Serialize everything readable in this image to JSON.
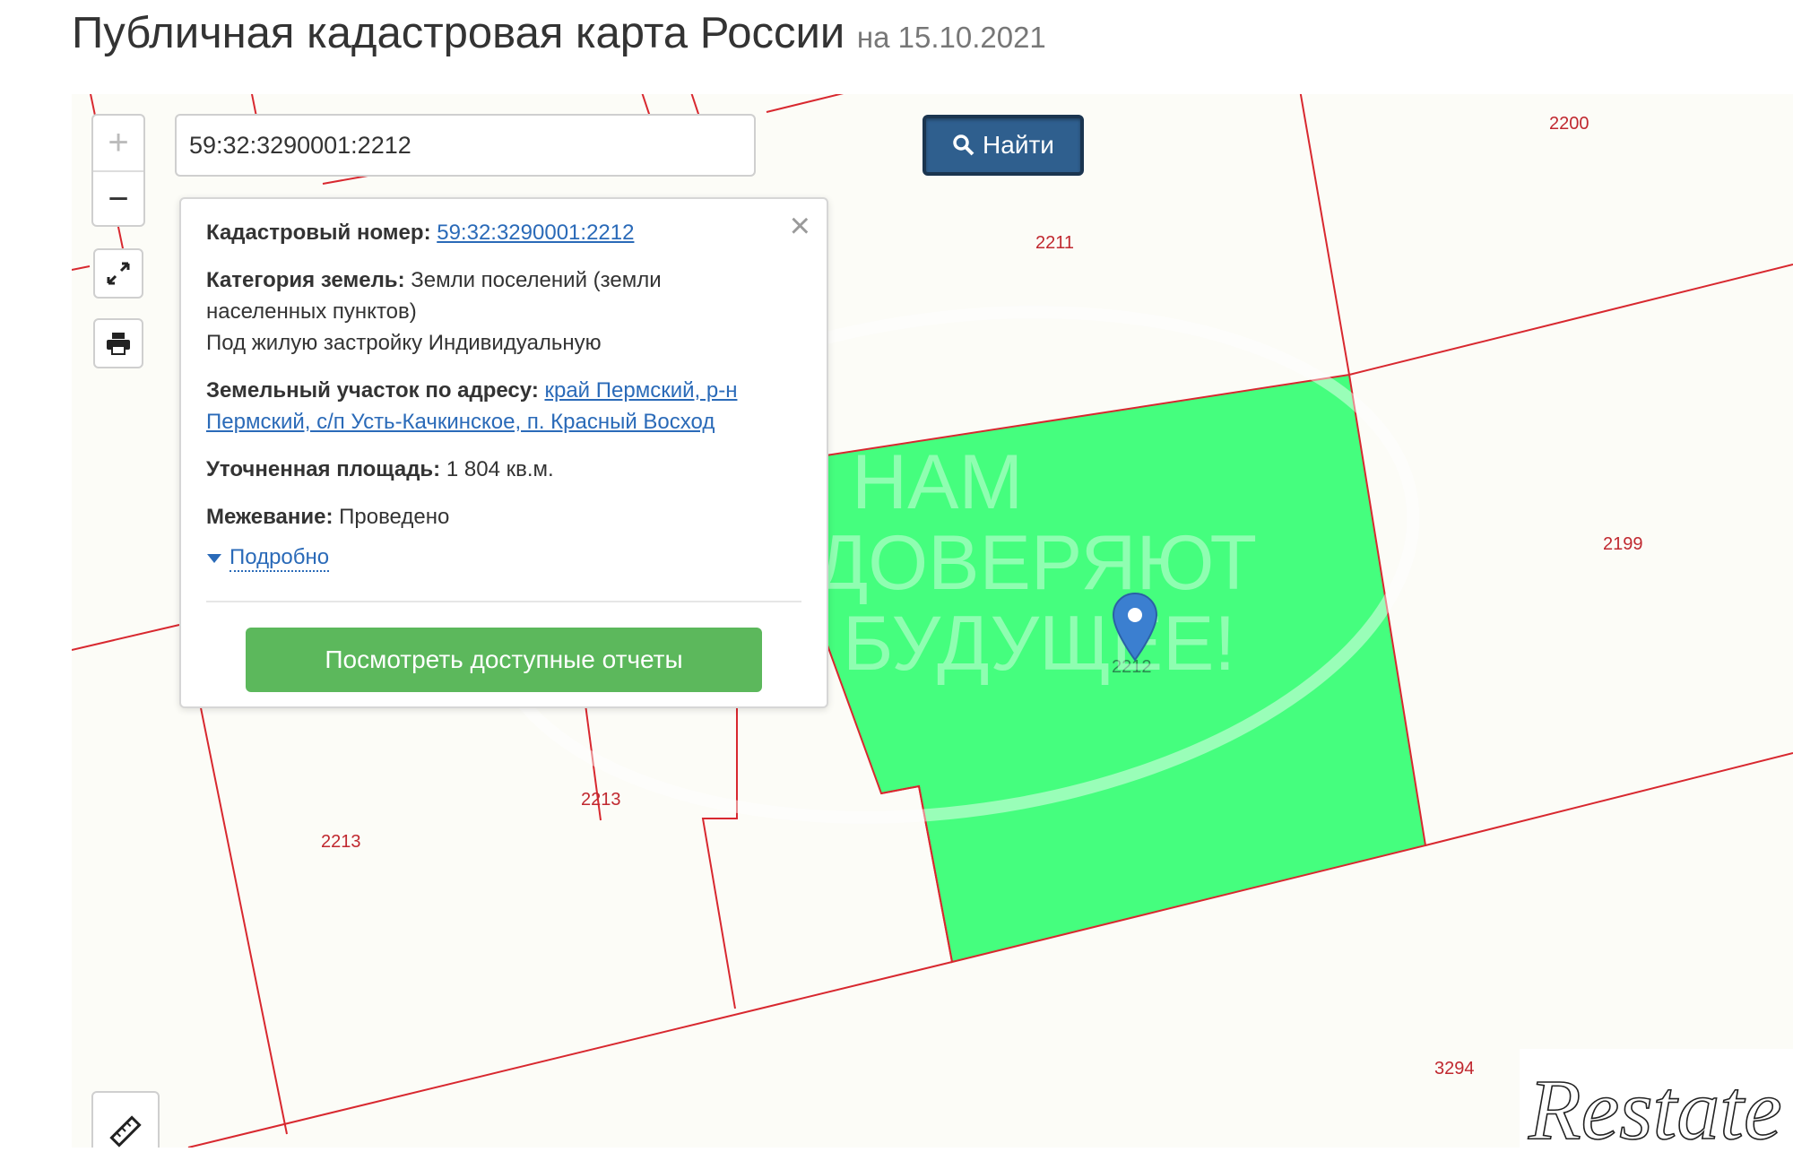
{
  "page": {
    "title": "Публичная кадастровая карта России",
    "date": "на 15.10.2021"
  },
  "map": {
    "search": {
      "value": "59:32:3290001:2212",
      "button_label": "Найти"
    },
    "controls": {
      "zoom_in_icon": "plus-icon",
      "zoom_out_icon": "minus-icon",
      "fullscreen_icon": "expand-icon",
      "print_icon": "print-icon",
      "ruler_icon": "ruler-icon"
    },
    "parcel_labels": {
      "p2200": "2200",
      "p2211": "2211",
      "p2199": "2199",
      "p2213a": "2213",
      "p2213b": "2213",
      "p3294": "3294",
      "p2212": "2212"
    },
    "watermark": {
      "line1": "НАМ",
      "line2": "ДОВЕРЯЮТ",
      "line3": "БУДУЩЕЕ!"
    },
    "logo_text": "Restate",
    "colors": {
      "selected_parcel": "#45fe7e",
      "boundary": "#d8282f",
      "label": "#c0282f",
      "map_bg": "#fcfcf7"
    }
  },
  "popup": {
    "cadastral_label": "Кадастровый номер:",
    "cadastral_value": "59:32:3290001:2212",
    "category_label": "Категория земель:",
    "category_value": "Земли поселений (земли населенных пунктов)",
    "usage": "Под жилую застройку Индивидуальную",
    "address_label": "Земельный участок по адресу:",
    "address_value": "край Пермский, р-н Пермский, с/п Усть-Качкинское, п. Красный Восход",
    "area_label": "Уточненная площадь:",
    "area_value": "1 804 кв.м.",
    "survey_label": "Межевание:",
    "survey_value": "Проведено",
    "more_label": "Подробно",
    "reports_button": "Посмотреть доступные отчеты",
    "close_icon": "close-icon"
  }
}
